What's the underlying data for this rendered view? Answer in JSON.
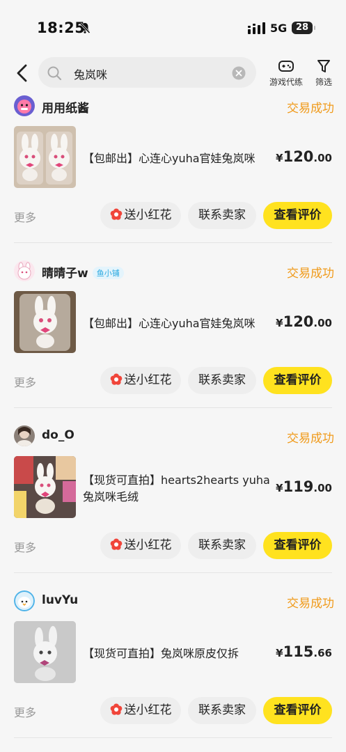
{
  "status_bar": {
    "time": "18:25",
    "network": "5G",
    "battery": "28"
  },
  "search": {
    "query": "兔岚咪"
  },
  "tools": {
    "game_label": "游戏代练",
    "filter_label": "筛选"
  },
  "orders": [
    {
      "seller": "用用纸酱",
      "badge": "",
      "status": "交易成功",
      "title": "【包邮出】心连心yuha官娃兔岚咪",
      "price_currency": "¥",
      "price_int": "120",
      "price_dec": ".00",
      "more": "更多",
      "flower_btn": "送小红花",
      "contact_btn": "联系卖家",
      "review_btn": "查看评价"
    },
    {
      "seller": "晴晴子w",
      "badge": "鱼小铺",
      "status": "交易成功",
      "title": "【包邮出】心连心yuha官娃兔岚咪",
      "price_currency": "¥",
      "price_int": "120",
      "price_dec": ".00",
      "more": "更多",
      "flower_btn": "送小红花",
      "contact_btn": "联系卖家",
      "review_btn": "查看评价"
    },
    {
      "seller": "do_O",
      "badge": "",
      "status": "交易成功",
      "title": "【现货可直拍】hearts2hearts yuha兔岚咪毛绒",
      "price_currency": "¥",
      "price_int": "119",
      "price_dec": ".00",
      "more": "更多",
      "flower_btn": "送小红花",
      "contact_btn": "联系卖家",
      "review_btn": "查看评价"
    },
    {
      "seller": "luvYu",
      "badge": "",
      "status": "交易成功",
      "title": "【现货可直拍】兔岚咪原皮仅拆",
      "price_currency": "¥",
      "price_int": "115",
      "price_dec": ".66",
      "more": "更多",
      "flower_btn": "送小红花",
      "contact_btn": "联系卖家",
      "review_btn": "查看评价"
    }
  ],
  "colors": {
    "accent_yellow": "#ffe21f",
    "status_orange": "#f09a1a",
    "flower_red": "#f0453a"
  },
  "icons": [
    "back-arrow-icon",
    "search-icon",
    "clear-icon",
    "gamepad-icon",
    "filter-icon",
    "flower-icon",
    "bell-muted-icon",
    "signal-icon"
  ]
}
